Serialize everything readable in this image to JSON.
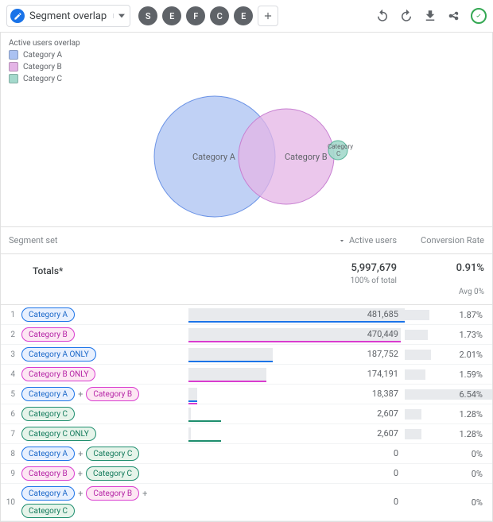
{
  "header": {
    "title": "Segment overlap",
    "tabs": [
      "S",
      "E",
      "F",
      "C",
      "E"
    ]
  },
  "legend": {
    "title": "Active users overlap",
    "items": [
      {
        "label": "Category A",
        "color": "#abc2f2"
      },
      {
        "label": "Category B",
        "color": "#e4b4e6"
      },
      {
        "label": "Category C",
        "color": "#a4d9cc"
      }
    ]
  },
  "chart_data": {
    "type": "venn",
    "sets": [
      {
        "name": "Category A",
        "size": 481685,
        "color": "#abc2f2"
      },
      {
        "name": "Category B",
        "size": 470449,
        "color": "#e4b4e6"
      },
      {
        "name": "Category C",
        "size": 2607,
        "color": "#a4d9cc"
      }
    ],
    "intersections": [
      {
        "sets": [
          "Category A",
          "Category B"
        ],
        "size": 18387
      }
    ]
  },
  "columns": {
    "segment": "Segment set",
    "active": "Active users",
    "conv": "Conversion Rate"
  },
  "totals": {
    "label": "Totals*",
    "active": "5,997,679",
    "active_sub": "100% of total",
    "conv": "0.91%",
    "conv_sub": "Avg 0%"
  },
  "rows": [
    {
      "idx": "1",
      "chips": [
        {
          "t": "Category A",
          "c": "a"
        }
      ],
      "val": "481,685",
      "bar": 100,
      "colors": [
        {
          "c": "#1a73e8",
          "y": 0,
          "w": 100
        }
      ],
      "cr": "1.87%",
      "crbar": 28
    },
    {
      "idx": "2",
      "chips": [
        {
          "t": "Category B",
          "c": "b"
        }
      ],
      "val": "470,449",
      "bar": 98,
      "colors": [
        {
          "c": "#d93ccf",
          "y": 0,
          "w": 98
        }
      ],
      "cr": "1.73%",
      "crbar": 26
    },
    {
      "idx": "3",
      "chips": [
        {
          "t": "Category A ONLY",
          "c": "a"
        }
      ],
      "val": "187,752",
      "bar": 39,
      "colors": [
        {
          "c": "#1a73e8",
          "y": 0,
          "w": 39
        }
      ],
      "cr": "2.01%",
      "crbar": 30
    },
    {
      "idx": "4",
      "chips": [
        {
          "t": "Category B ONLY",
          "c": "b"
        }
      ],
      "val": "174,191",
      "bar": 36,
      "colors": [
        {
          "c": "#d93ccf",
          "y": 0,
          "w": 36
        }
      ],
      "cr": "1.59%",
      "crbar": 24
    },
    {
      "idx": "5",
      "chips": [
        {
          "t": "Category A",
          "c": "a"
        },
        {
          "t": "Category B",
          "c": "b"
        }
      ],
      "val": "18,387",
      "bar": 4,
      "colors": [
        {
          "c": "#1a73e8",
          "y": 0,
          "w": 4
        },
        {
          "c": "#d93ccf",
          "y": 3,
          "w": 4
        }
      ],
      "cr": "6.54%",
      "crbar": 100
    },
    {
      "idx": "6",
      "chips": [
        {
          "t": "Category C",
          "c": "c"
        }
      ],
      "val": "2,607",
      "bar": 1,
      "colors": [
        {
          "c": "#1e8e6e",
          "y": 0,
          "w": 15
        }
      ],
      "cr": "1.28%",
      "crbar": 19
    },
    {
      "idx": "7",
      "chips": [
        {
          "t": "Category C ONLY",
          "c": "c"
        }
      ],
      "val": "2,607",
      "bar": 1,
      "colors": [
        {
          "c": "#1e8e6e",
          "y": 0,
          "w": 15
        }
      ],
      "cr": "1.28%",
      "crbar": 19
    },
    {
      "idx": "8",
      "chips": [
        {
          "t": "Category A",
          "c": "a"
        },
        {
          "t": "Category C",
          "c": "c"
        }
      ],
      "val": "0",
      "bar": 0,
      "colors": [],
      "cr": "0%",
      "crbar": 0
    },
    {
      "idx": "9",
      "chips": [
        {
          "t": "Category B",
          "c": "b"
        },
        {
          "t": "Category C",
          "c": "c"
        }
      ],
      "val": "0",
      "bar": 0,
      "colors": [],
      "cr": "0%",
      "crbar": 0
    },
    {
      "idx": "10",
      "chips": [
        {
          "t": "Category A",
          "c": "a"
        },
        {
          "t": "Category B",
          "c": "b"
        },
        {
          "t": "Category C",
          "c": "c"
        }
      ],
      "val": "0",
      "bar": 0,
      "colors": [],
      "cr": "0%",
      "crbar": 0
    }
  ]
}
